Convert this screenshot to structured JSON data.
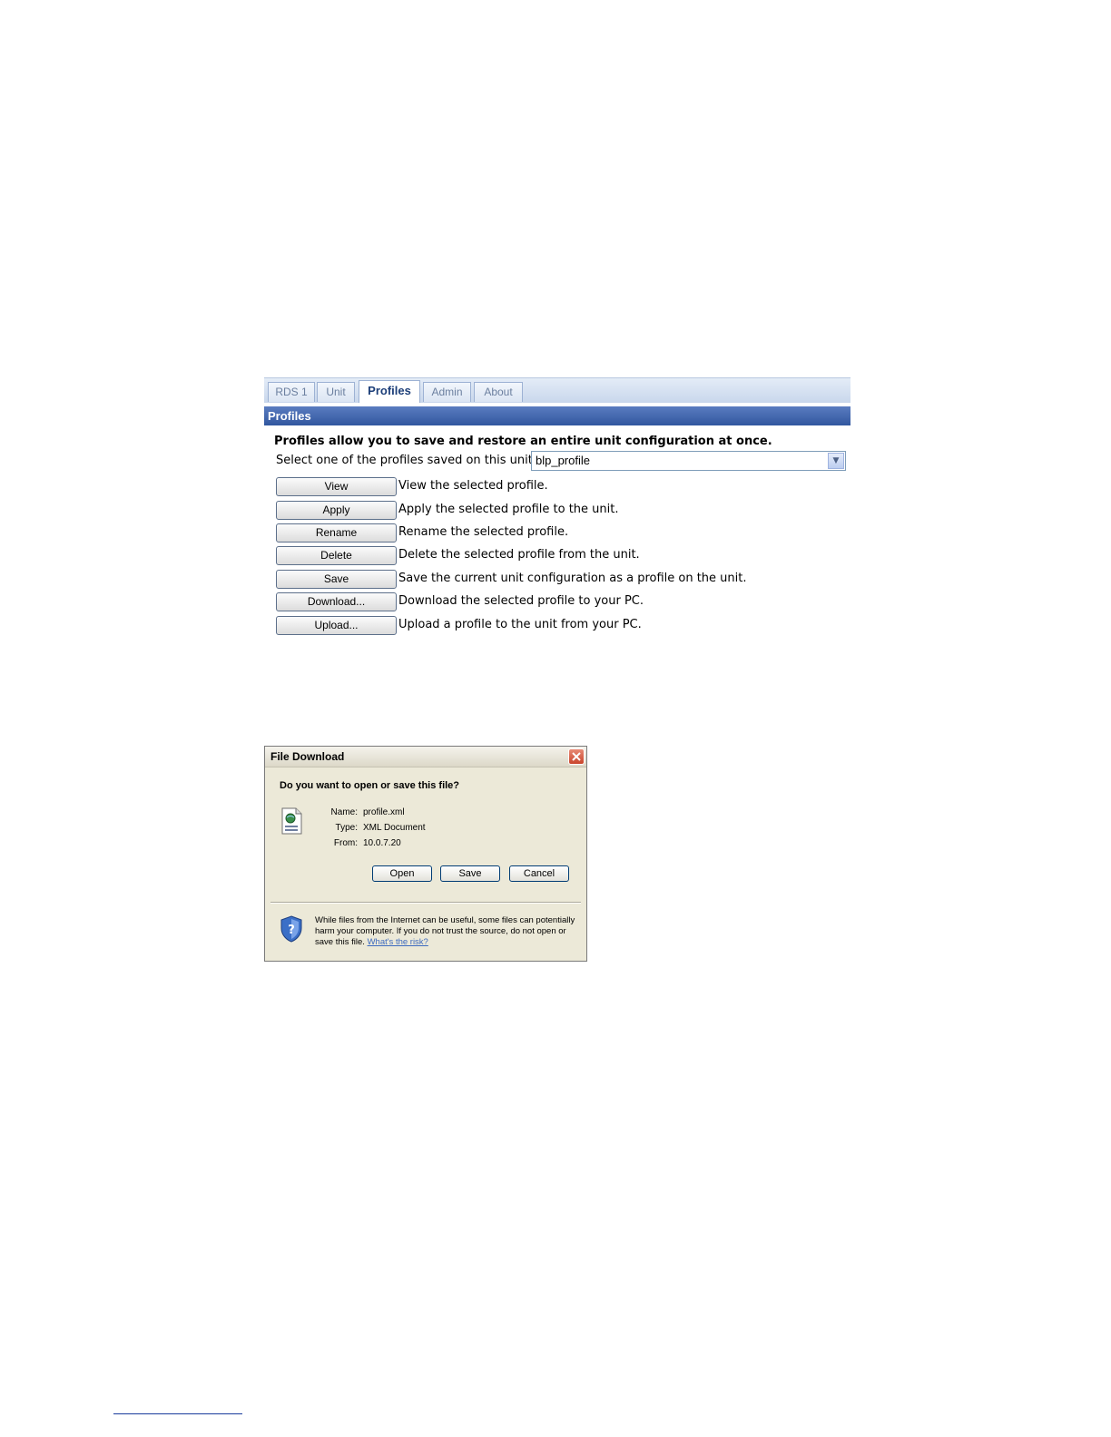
{
  "profiles_panel": {
    "tabs": [
      {
        "label": "RDS 1"
      },
      {
        "label": "Unit"
      },
      {
        "label": "Profiles",
        "active": true
      },
      {
        "label": "Admin"
      },
      {
        "label": "About"
      }
    ],
    "section_title": "Profiles",
    "intro_text": "Profiles allow you to save and restore an entire unit configuration at once.",
    "select_label": "Select one of the profiles saved on this unit.",
    "select_value": "blp_profile",
    "actions": [
      {
        "label": "View",
        "description": "View the selected profile."
      },
      {
        "label": "Apply",
        "description": "Apply the selected profile to the unit."
      },
      {
        "label": "Rename",
        "description": "Rename the selected profile."
      },
      {
        "label": "Delete",
        "description": "Delete the selected profile from the unit."
      },
      {
        "label": "Save",
        "description": "Save the current unit configuration as a profile on the unit."
      },
      {
        "label": "Download...",
        "description": "Download the selected profile to your PC."
      },
      {
        "label": "Upload...",
        "description": "Upload a profile to the unit from your PC."
      }
    ],
    "colors": {
      "header_bg": "#31579f",
      "tab_active_text": "#1d3f79"
    }
  },
  "file_download_dialog": {
    "title": "File Download",
    "question": "Do you want to open or save this file?",
    "name_label": "Name:",
    "name_value": "profile.xml",
    "type_label": "Type:",
    "type_value": "XML Document",
    "from_label": "From:",
    "from_value": "10.0.7.20",
    "buttons": {
      "open": "Open",
      "save": "Save",
      "cancel": "Cancel"
    },
    "warning_text": "While files from the Internet can be useful, some files can potentially harm your computer. If you do not trust the source, do not open or save this file.",
    "warning_link": "What's the risk?",
    "icons": {
      "file": "xml-file-icon",
      "shield": "security-shield-icon",
      "close": "close-icon"
    }
  }
}
